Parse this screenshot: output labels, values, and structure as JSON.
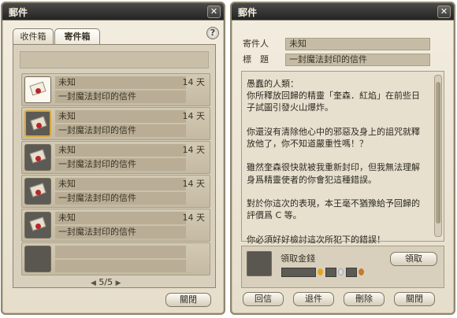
{
  "left_window": {
    "title": "郵件",
    "close_glyph": "✕",
    "tabs": [
      {
        "label": "收件箱"
      },
      {
        "label": "寄件箱"
      }
    ],
    "help_glyph": "?",
    "mails": [
      {
        "sender": "未知",
        "subject": "一封魔法封印的信件",
        "days": "14 天",
        "state": "unread"
      },
      {
        "sender": "未知",
        "subject": "一封魔法封印的信件",
        "days": "14 天",
        "state": "selected"
      },
      {
        "sender": "未知",
        "subject": "一封魔法封印的信件",
        "days": "14 天",
        "state": "read"
      },
      {
        "sender": "未知",
        "subject": "一封魔法封印的信件",
        "days": "14 天",
        "state": "read"
      },
      {
        "sender": "未知",
        "subject": "一封魔法封印的信件",
        "days": "14 天",
        "state": "read"
      }
    ],
    "pager": {
      "current": 5,
      "total": 5,
      "text": "5/5"
    },
    "close_button_label": "關閉"
  },
  "right_window": {
    "title": "郵件",
    "close_glyph": "✕",
    "sender_label": "寄件人",
    "sender_value": "未知",
    "subject_label": "標　題",
    "subject_value": "一封魔法封印的信件",
    "body": "愚蠢的人類：\n你所釋放回歸的精靈「奎森．紅焰」在前些日子試圖引發火山爆炸。\n\n你還沒有清除他心中的邪惡及身上的詛咒就釋放他了，你不知道嚴重性嗎！？\n\n雖然奎森很快就被我重新封印，但我無法理解身爲精靈使者的你會犯這種錯誤。\n\n對於你這次的表現，本王毫不猶豫給予回歸的評價爲 C 等。\n\n你必須好好檢討這次所犯下的錯誤！",
    "attachment": {
      "label": "領取金錢",
      "claim_label": "領取"
    },
    "buttons": {
      "reply": "回信",
      "return": "退件",
      "delete": "刪除",
      "close": "關閉"
    }
  },
  "colors": {
    "titlebar": "#2f2f2d",
    "panel": "#e6decb",
    "seal_red": "#b8262a",
    "gold_coin": "#e3a51d",
    "silver_coin": "#d6dde6",
    "copper_coin": "#c87a2a"
  },
  "icons": [
    "close-icon",
    "help-icon",
    "sealed-letter-icon",
    "coin-gold-icon",
    "coin-silver-icon",
    "coin-copper-icon",
    "left-arrow-icon",
    "right-arrow-icon"
  ]
}
